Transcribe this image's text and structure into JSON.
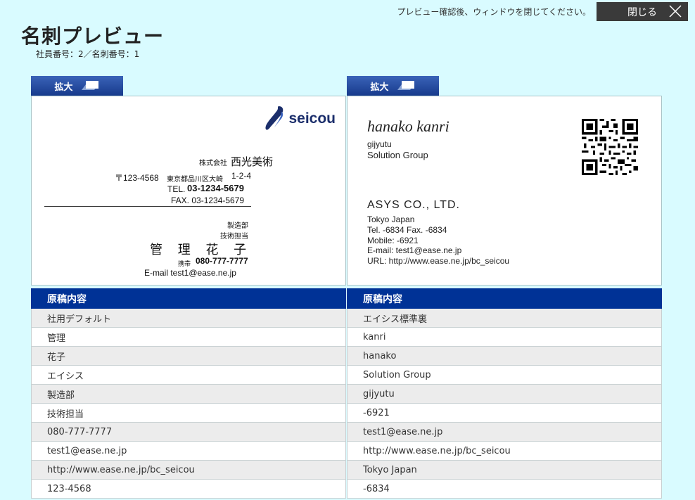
{
  "topbar": {
    "note": "プレビュー確認後、ウィンドウを閉じてください。",
    "close_label": "閉じる"
  },
  "page": {
    "title": "名刺プレビュー",
    "subtitle": "社員番号：2／名刺番号：1"
  },
  "zoom_label": "拡大",
  "front_card": {
    "logo_text": "seicou",
    "company_prefix": "株式会社",
    "company_name": "西光美術",
    "zip": "〒123-4568",
    "address_small": "東京都品川区大崎",
    "address_num": "1-2-4",
    "tel_label": "TEL.",
    "tel": "03-1234-5679",
    "fax": "FAX. 03-1234-5679",
    "dept": "製造部",
    "role": "技術担当",
    "name": "管 理 花 子",
    "mobile_label": "携帯",
    "mobile": "080-777-7777",
    "email": "E-mail test1@ease.ne.jp"
  },
  "back_card": {
    "name": "hanako  kanri",
    "dept": "gijyutu",
    "group": "Solution Group",
    "company": "ASYS CO., LTD.",
    "city": "Tokyo Japan",
    "tel_fax": "Tel. -6834  Fax. -6834",
    "mobile": "Mobile: -6921",
    "email": "E-mail: test1@ease.ne.jp",
    "url": "URL: http://www.ease.ne.jp/bc_seicou"
  },
  "front_table": {
    "header": "原稿内容",
    "rows": [
      "社用デフォルト",
      "管理",
      "花子",
      "エイシス",
      "製造部",
      "技術担当",
      "080-777-7777",
      "test1@ease.ne.jp",
      "http://www.ease.ne.jp/bc_seicou",
      "123-4568"
    ]
  },
  "back_table": {
    "header": "原稿内容",
    "rows": [
      "エイシス標準裏",
      "kanri",
      "hanako",
      "Solution Group",
      "gijyutu",
      "-6921",
      "test1@ease.ne.jp",
      "http://www.ease.ne.jp/bc_seicou",
      "Tokyo Japan",
      "-6834"
    ]
  },
  "colors": {
    "background": "#d9fbff",
    "table_header": "#003296",
    "zoom_button": "#173a8c",
    "close_button": "#3a3a3a",
    "logo": "#1b2e6b"
  }
}
